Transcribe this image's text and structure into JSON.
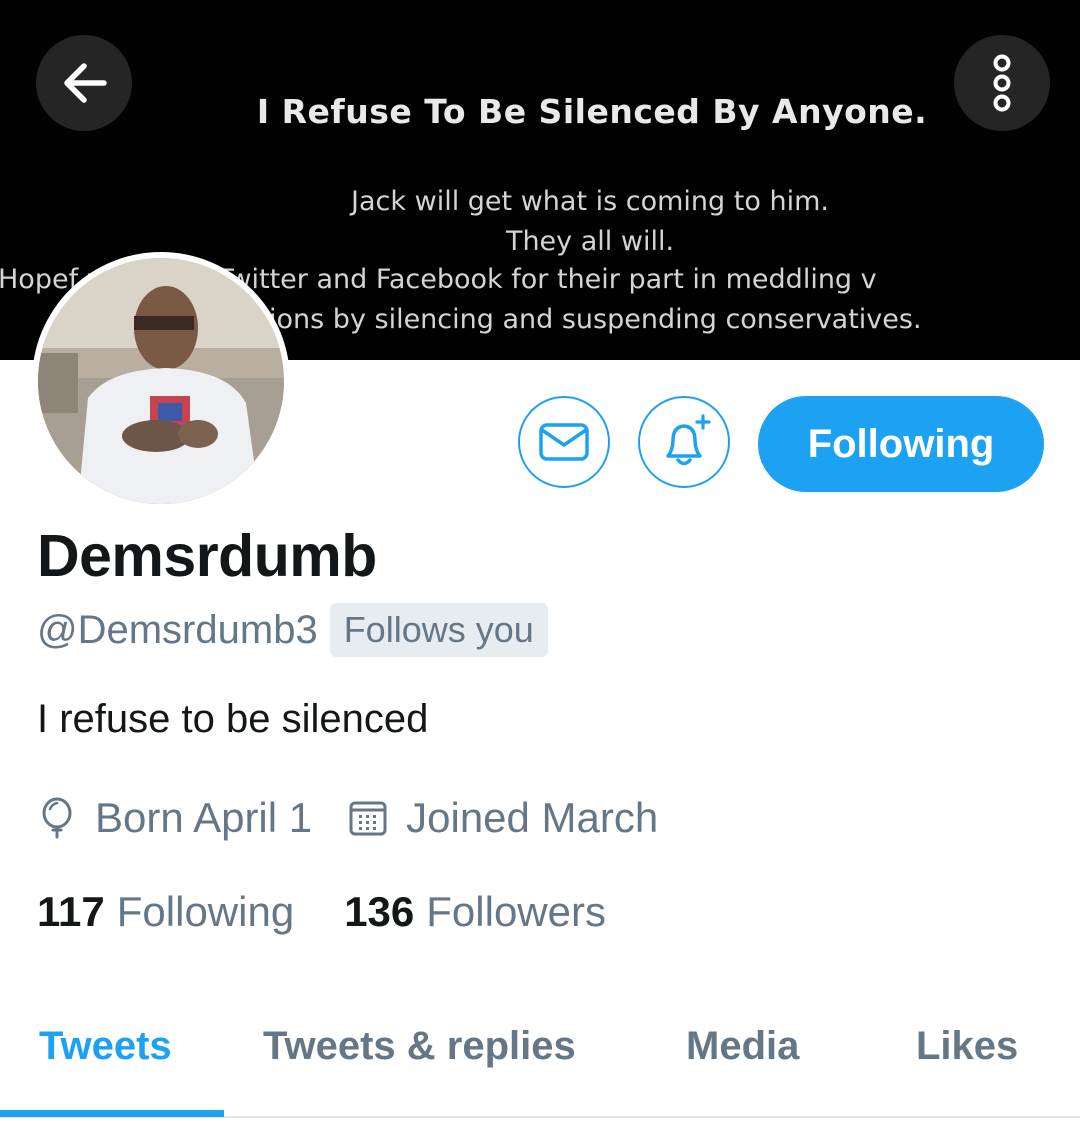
{
  "banner": {
    "headline": "I Refuse To Be Silenced By Anyone.",
    "line1": "Jack will get what is coming to him.",
    "line2": "They all will.",
    "line3": "Hopef      will seize Twitter and Facebook for their part in meddling v",
    "line4": "tions by silencing and suspending conservatives."
  },
  "profile": {
    "display_name": "Demsrdumb",
    "handle": "@Demsrdumb3",
    "follows_you": "Follows you",
    "bio": "I refuse to be silenced",
    "birthday": "Born April 1",
    "joined": "Joined March"
  },
  "actions": {
    "following_label": "Following"
  },
  "stats": {
    "following_count": "117",
    "following_label": "Following",
    "followers_count": "136",
    "followers_label": "Followers"
  },
  "tabs": [
    {
      "label": "Tweets",
      "active": true
    },
    {
      "label": "Tweets & replies",
      "active": false
    },
    {
      "label": "Media",
      "active": false
    },
    {
      "label": "Likes",
      "active": false
    }
  ],
  "colors": {
    "accent": "#1da1f2",
    "text_primary": "#14171a",
    "text_secondary": "#657786"
  },
  "icons": [
    "back-arrow-icon",
    "more-options-icon",
    "mail-icon",
    "bell-plus-icon",
    "balloon-icon",
    "calendar-icon"
  ]
}
